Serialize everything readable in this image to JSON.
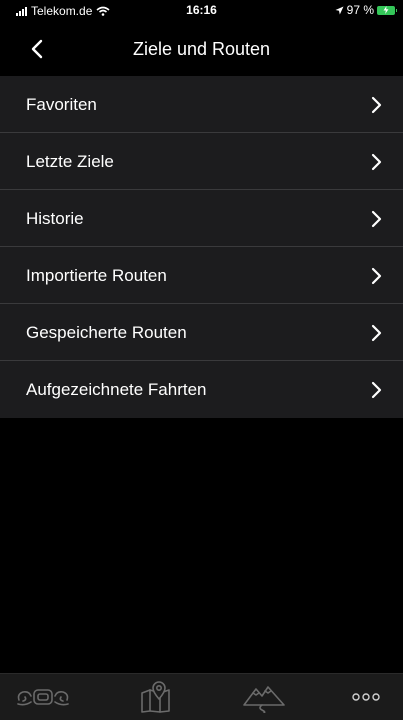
{
  "status_bar": {
    "carrier": "Telekom.de",
    "time": "16:16",
    "battery_percent": "97 %"
  },
  "header": {
    "title": "Ziele und Routen"
  },
  "list": {
    "items": [
      {
        "label": "Favoriten"
      },
      {
        "label": "Letzte Ziele"
      },
      {
        "label": "Historie"
      },
      {
        "label": "Importierte Routen"
      },
      {
        "label": "Gespeicherte Routen"
      },
      {
        "label": "Aufgezeichnete Fahrten"
      }
    ]
  },
  "tab_bar": {
    "tabs": [
      {
        "icon": "motorcycle-icon"
      },
      {
        "icon": "map-pin-icon"
      },
      {
        "icon": "mountains-route-icon"
      },
      {
        "icon": "more-dots-icon"
      }
    ]
  },
  "colors": {
    "background": "#000000",
    "list_background": "#1c1c1e",
    "separator": "#3a3a3c",
    "tab_bar": "#1b1b1b",
    "battery": "#34c759"
  }
}
